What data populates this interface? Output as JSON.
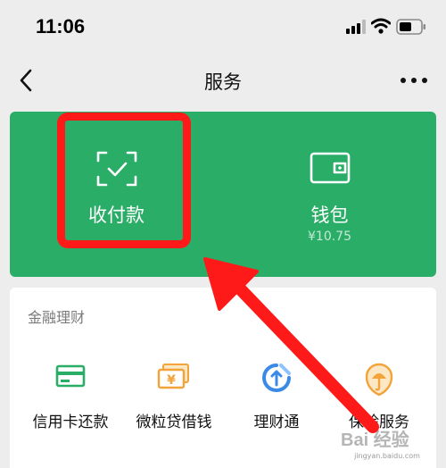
{
  "status_bar": {
    "time": "11:06"
  },
  "nav": {
    "title": "服务"
  },
  "green_card": {
    "pay": {
      "label": "收付款"
    },
    "wallet": {
      "label": "钱包",
      "balance": "¥10.75"
    }
  },
  "finance": {
    "title": "金融理财",
    "items": [
      {
        "label": "信用卡还款",
        "icon": "credit-card-icon",
        "color": "#2aae67"
      },
      {
        "label": "微粒贷借钱",
        "icon": "yuan-coin-icon",
        "color": "#f2a33a"
      },
      {
        "label": "理财通",
        "icon": "licaitong-icon",
        "color": "#3a8ae6"
      },
      {
        "label": "保险服务",
        "icon": "shield-umbrella-icon",
        "color": "#f2a33a"
      }
    ]
  },
  "colors": {
    "brand_green": "#2aae67",
    "annotation_red": "#ff1a1a"
  },
  "watermark": {
    "logo": "Bai 经验",
    "url": "jingyan.baidu.com"
  }
}
